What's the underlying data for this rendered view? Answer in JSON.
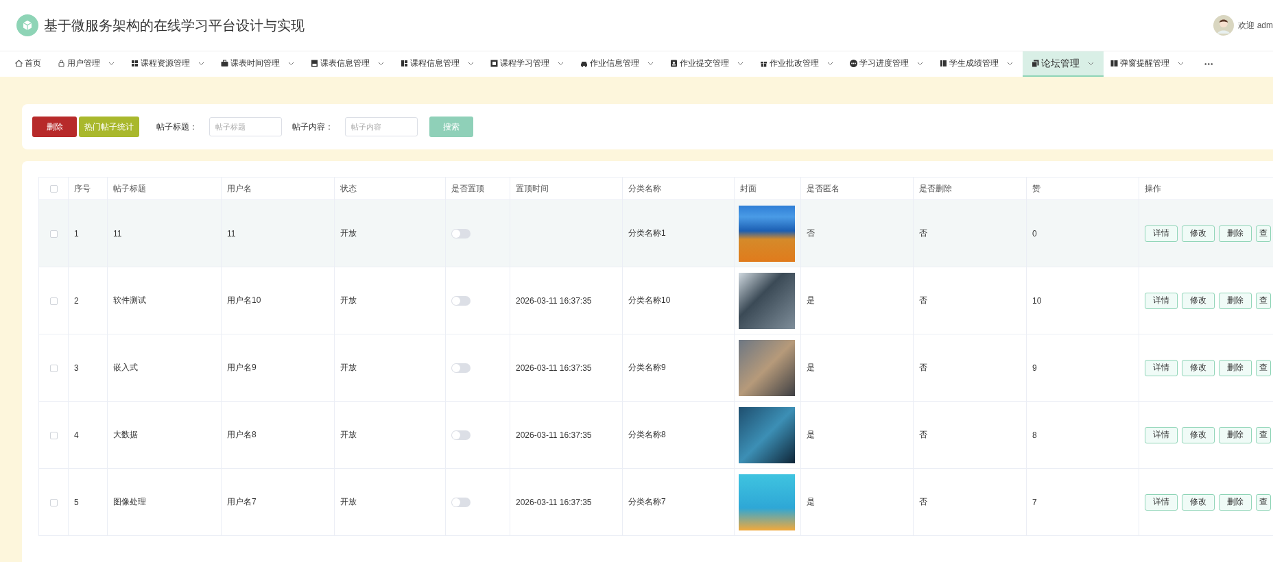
{
  "header": {
    "title": "基于微服务架构的在线学习平台设计与实现",
    "welcome": "欢迎 adm"
  },
  "nav": {
    "items": [
      {
        "label": "首页",
        "selected": false,
        "dropdown": false
      },
      {
        "label": "用户管理",
        "selected": false,
        "dropdown": true
      },
      {
        "label": "课程资源管理",
        "selected": false,
        "dropdown": true
      },
      {
        "label": "课表时间管理",
        "selected": false,
        "dropdown": true
      },
      {
        "label": "课表信息管理",
        "selected": false,
        "dropdown": true
      },
      {
        "label": "课程信息管理",
        "selected": false,
        "dropdown": true
      },
      {
        "label": "课程学习管理",
        "selected": false,
        "dropdown": true
      },
      {
        "label": "作业信息管理",
        "selected": false,
        "dropdown": true
      },
      {
        "label": "作业提交管理",
        "selected": false,
        "dropdown": true
      },
      {
        "label": "作业批改管理",
        "selected": false,
        "dropdown": true
      },
      {
        "label": "学习进度管理",
        "selected": false,
        "dropdown": true
      },
      {
        "label": "学生成绩管理",
        "selected": false,
        "dropdown": true
      },
      {
        "label": "论坛管理",
        "selected": true,
        "dropdown": true
      },
      {
        "label": "弹窗提醒管理",
        "selected": false,
        "dropdown": true
      }
    ],
    "more": "•••"
  },
  "toolbar": {
    "delete_button": "删除",
    "stats_button": "热门帖子统计",
    "filters": [
      {
        "label": "帖子标题：",
        "placeholder": "帖子标题"
      },
      {
        "label": "帖子内容：",
        "placeholder": "帖子内容"
      }
    ],
    "search_button": "搜索"
  },
  "table": {
    "select_all": {
      "checked": false
    },
    "columns": [
      "序号",
      "帖子标题",
      "用户名",
      "状态",
      "是否置顶",
      "置顶时间",
      "分类名称",
      "封面",
      "是否匿名",
      "是否删除",
      "赞",
      "操作"
    ],
    "rows": [
      {
        "checked": false,
        "hovered": true,
        "pinned": false,
        "index": "1",
        "title": "11",
        "user": "11",
        "status": "开放",
        "category": "分类名称1",
        "anonymous": "否",
        "deleted": "否",
        "likes": "0",
        "actions": [
          "详情",
          "修改",
          "删除",
          "查"
        ]
      },
      {
        "checked": false,
        "hovered": false,
        "pinned": false,
        "index": "2",
        "title": "软件测试",
        "user": "用户名10",
        "status": "开放",
        "pin_time": "2026-03-11 16:37:35",
        "category": "分类名称10",
        "anonymous": "是",
        "deleted": "否",
        "likes": "10",
        "actions": [
          "详情",
          "修改",
          "删除",
          "查"
        ]
      },
      {
        "checked": false,
        "hovered": false,
        "pinned": false,
        "index": "3",
        "title": "嵌入式",
        "user": "用户名9",
        "status": "开放",
        "pin_time": "2026-03-11 16:37:35",
        "category": "分类名称9",
        "anonymous": "是",
        "deleted": "否",
        "likes": "9",
        "actions": [
          "详情",
          "修改",
          "删除",
          "查"
        ]
      },
      {
        "checked": false,
        "hovered": false,
        "pinned": false,
        "index": "4",
        "title": "大数据",
        "user": "用户名8",
        "status": "开放",
        "pin_time": "2026-03-11 16:37:35",
        "category": "分类名称8",
        "anonymous": "是",
        "deleted": "否",
        "likes": "8",
        "actions": [
          "详情",
          "修改",
          "删除",
          "查"
        ]
      },
      {
        "checked": false,
        "hovered": false,
        "pinned": false,
        "index": "5",
        "title": "图像处理",
        "user": "用户名7",
        "status": "开放",
        "pin_time": "2026-03-11 16:37:35",
        "category": "分类名称7",
        "anonymous": "是",
        "deleted": "否",
        "likes": "7",
        "actions": [
          "详情",
          "修改",
          "删除",
          "查"
        ]
      }
    ]
  }
}
